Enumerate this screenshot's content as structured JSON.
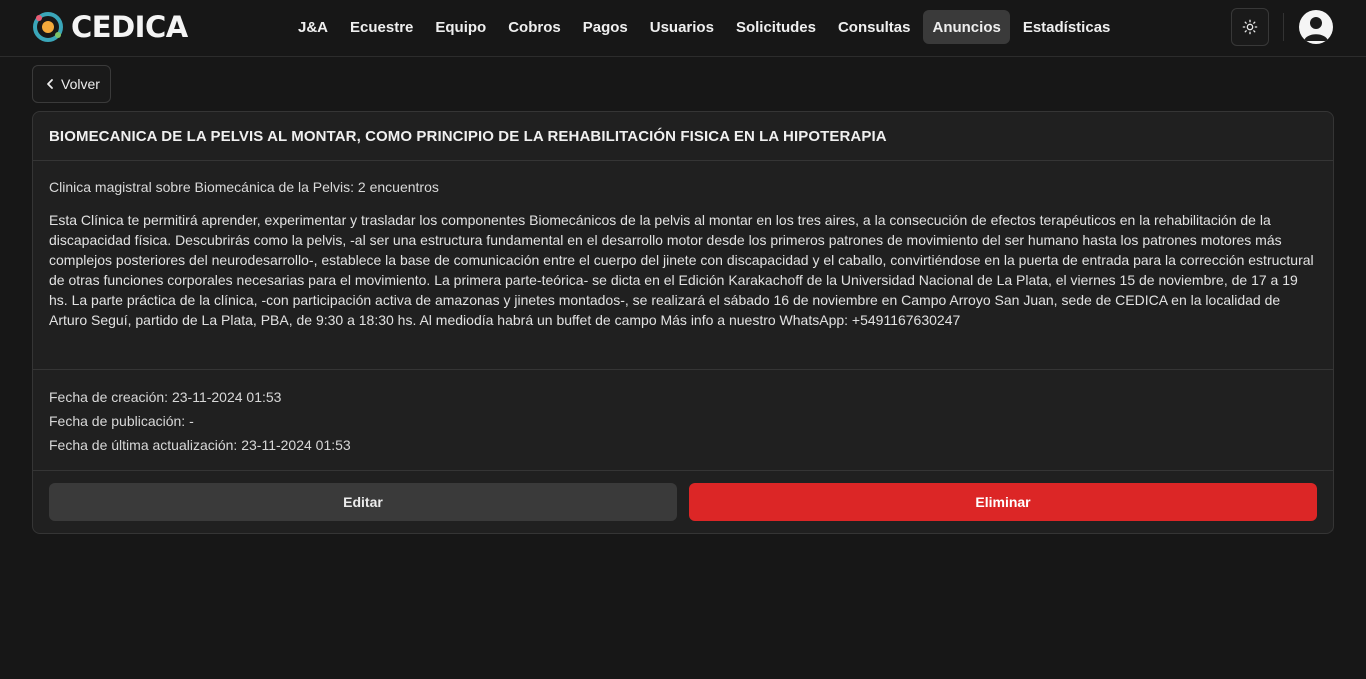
{
  "brand": {
    "name": "CEDICA"
  },
  "nav": {
    "items": [
      {
        "label": "J&A",
        "active": false
      },
      {
        "label": "Ecuestre",
        "active": false
      },
      {
        "label": "Equipo",
        "active": false
      },
      {
        "label": "Cobros",
        "active": false
      },
      {
        "label": "Pagos",
        "active": false
      },
      {
        "label": "Usuarios",
        "active": false
      },
      {
        "label": "Solicitudes",
        "active": false
      },
      {
        "label": "Consultas",
        "active": false
      },
      {
        "label": "Anuncios",
        "active": true
      },
      {
        "label": "Estadísticas",
        "active": false
      }
    ]
  },
  "header_icons": {
    "theme": "sun-icon",
    "user": "user-avatar-icon"
  },
  "back": {
    "label": "Volver",
    "icon": "chevron-left-icon"
  },
  "announcement": {
    "title": "BIOMECANICA DE LA PELVIS AL MONTAR, COMO PRINCIPIO DE LA REHABILITACIÓN FISICA EN LA HIPOTERAPIA",
    "subtitle": "Clinica magistral sobre Biomecánica de la Pelvis: 2 encuentros",
    "description": "Esta Clínica te permitirá aprender, experimentar y trasladar los componentes Biomecánicos de la pelvis al montar en los tres aires, a la consecución de efectos terapéuticos en la rehabilitación de la discapacidad física. Descubrirás como la pelvis, -al ser una estructura fundamental en el desarrollo motor desde los primeros patrones de movimiento del ser humano hasta los patrones motores más complejos posteriores del neurodesarrollo-, establece la base de comunicación entre el cuerpo del jinete con discapacidad y el caballo, convirtiéndose en la puerta de entrada para la corrección estructural de otras funciones corporales necesarias para el movimiento. La primera parte-teórica- se dicta en el Edición Karakachoff de la Universidad Nacional de La Plata, el viernes 15 de noviembre, de 17 a 19 hs. La parte práctica de la clínica, -con participación activa de amazonas y jinetes montados-, se realizará el sábado 16 de noviembre en Campo Arroyo San Juan, sede de CEDICA en la localidad de Arturo Seguí, partido de La Plata, PBA, de 9:30 a 18:30 hs. Al mediodía habrá un buffet de campo Más info a nuestro WhatsApp: +5491167630247",
    "created": "Fecha de creación: 23-11-2024 01:53",
    "published": "Fecha de publicación: -",
    "updated": "Fecha de última actualización: 23-11-2024 01:53"
  },
  "actions": {
    "edit_label": "Editar",
    "delete_label": "Eliminar"
  },
  "colors": {
    "background": "#171717",
    "card": "#202020",
    "danger": "#dc2626",
    "secondary_button": "#3a3a3a"
  }
}
